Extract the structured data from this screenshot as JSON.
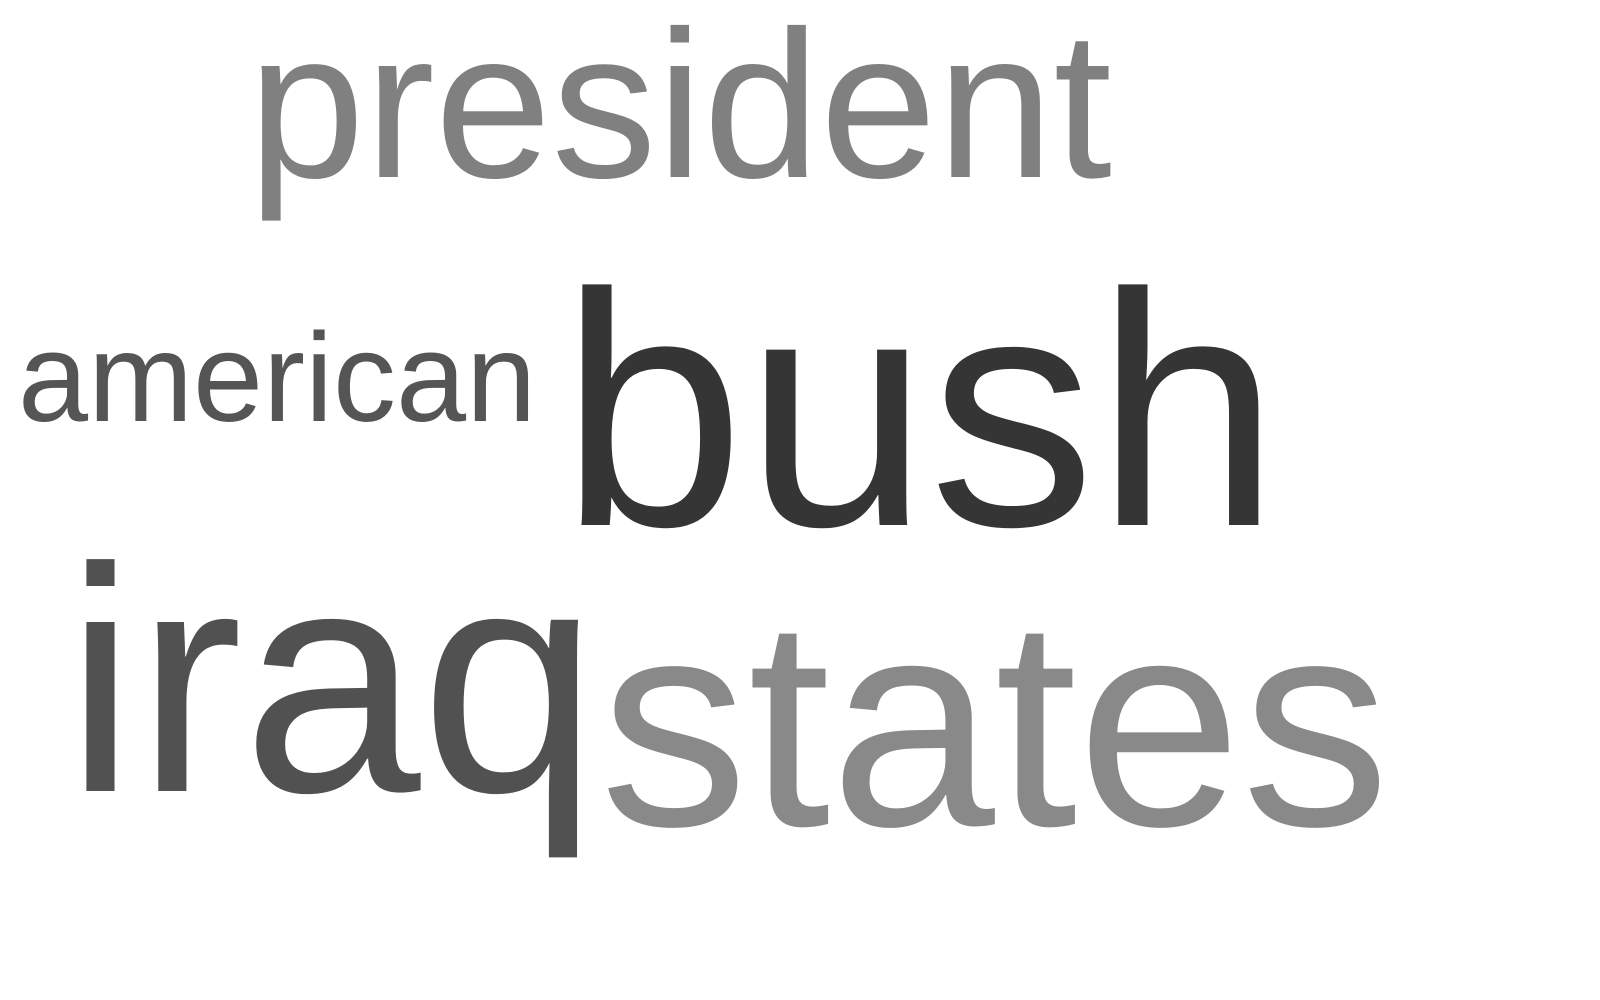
{
  "word_cloud": {
    "words": [
      {
        "text": "president",
        "color": "#808080"
      },
      {
        "text": "american",
        "color": "#555555"
      },
      {
        "text": "bush",
        "color": "#353535"
      },
      {
        "text": "iraq",
        "color": "#515151"
      },
      {
        "text": "states",
        "color": "#898989"
      }
    ]
  }
}
